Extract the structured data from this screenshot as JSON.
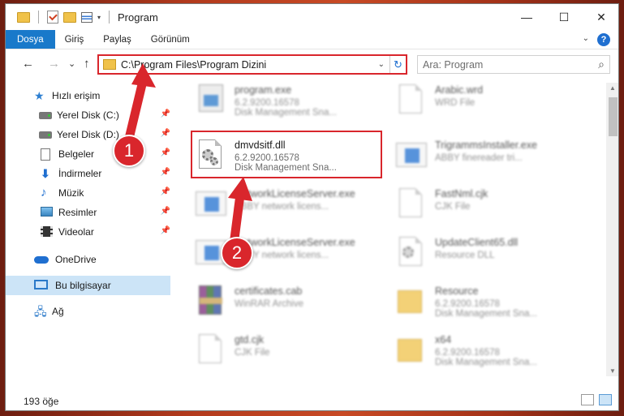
{
  "window": {
    "title": "Program",
    "minimize": "—",
    "maximize": "☐",
    "close": "✕"
  },
  "ribbon": {
    "tabs": [
      "Dosya",
      "Giriş",
      "Paylaş",
      "Görünüm"
    ],
    "help": "?"
  },
  "nav": {
    "back": "←",
    "forward": "→",
    "recent": "⌄",
    "up": "↑",
    "address": "C:\\Program Files\\Program Dizini",
    "refresh": "↻",
    "search_placeholder": "Ara: Program"
  },
  "sidebar": {
    "items": [
      {
        "label": "Hızlı erişim",
        "icon": "star-icon"
      },
      {
        "label": "Yerel Disk (C:)",
        "icon": "disk-icon",
        "pinned": true
      },
      {
        "label": "Yerel Disk (D:)",
        "icon": "disk-icon",
        "pinned": true
      },
      {
        "label": "Belgeler",
        "icon": "document-icon",
        "pinned": true
      },
      {
        "label": "İndirmeler",
        "icon": "download-icon",
        "pinned": true
      },
      {
        "label": "Müzik",
        "icon": "music-icon",
        "pinned": true
      },
      {
        "label": "Resimler",
        "icon": "pictures-icon",
        "pinned": true
      },
      {
        "label": "Videolar",
        "icon": "video-icon",
        "pinned": true
      },
      {
        "label": "OneDrive",
        "icon": "onedrive-icon"
      },
      {
        "label": "Bu bilgisayar",
        "icon": "computer-icon",
        "selected": true
      },
      {
        "label": "Ağ",
        "icon": "network-icon"
      }
    ]
  },
  "files": [
    {
      "name": "program.exe",
      "line2": "6.2.9200.16578",
      "line3": "Disk Management Sna...",
      "icon": "exe-icon",
      "blurred": true
    },
    {
      "name": "Arabic.wrd",
      "line2": "WRD File",
      "line3": "",
      "icon": "file-icon",
      "blurred": true
    },
    {
      "name": "dmvdsitf.dll",
      "line2": "6.2.9200.16578",
      "line3": "Disk Management Sna...",
      "icon": "dll-gear-icon",
      "blurred": false
    },
    {
      "name": "TrigrammsInstaller.exe",
      "line2": "ABBY finereader tri...",
      "line3": "",
      "icon": "app-icon",
      "blurred": true
    },
    {
      "name": "NetworkLicenseServer.exe",
      "line2": "ABBY network licens...",
      "line3": "",
      "icon": "app-icon",
      "blurred": true
    },
    {
      "name": "FastNml.cjk",
      "line2": "CJK File",
      "line3": "",
      "icon": "file-icon",
      "blurred": true
    },
    {
      "name": "NetworkLicenseServer.exe",
      "line2": "ABBY network licens...",
      "line3": "",
      "icon": "app-icon",
      "blurred": true
    },
    {
      "name": "UpdateClient65.dll",
      "line2": "Resource DLL",
      "line3": "",
      "icon": "dll-gear-icon",
      "blurred": true
    },
    {
      "name": "certificates.cab",
      "line2": "WinRAR Archive",
      "line3": "",
      "icon": "rar-icon",
      "blurred": true
    },
    {
      "name": "Resource",
      "line2": "6.2.9200.16578",
      "line3": "Disk Management Sna...",
      "icon": "folder-icon",
      "blurred": true
    },
    {
      "name": "gtd.cjk",
      "line2": "CJK File",
      "line3": "",
      "icon": "file-icon",
      "blurred": true
    },
    {
      "name": "x64",
      "line2": "6.2.9200.16578",
      "line3": "Disk Management Sna...",
      "icon": "folder-icon",
      "blurred": true
    }
  ],
  "annotations": {
    "badge1": "1",
    "badge2": "2",
    "highlight_color": "#d9262c"
  },
  "status": {
    "count": "193 öğe"
  },
  "colors": {
    "accent": "#1979ca",
    "selection": "#cce4f7"
  }
}
